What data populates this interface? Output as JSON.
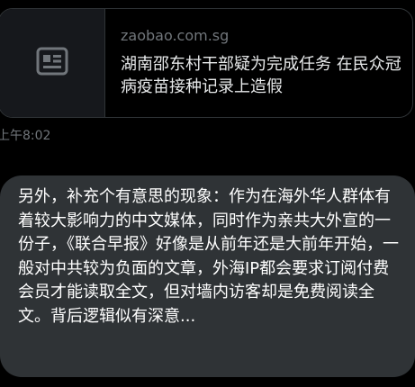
{
  "link_card": {
    "thumbnail_icon": "newspaper-icon",
    "domain": "zaobao.com.sg",
    "title": "湖南邵东村干部疑为完成任务 在民众冠病疫苗接种记录上造假"
  },
  "message": {
    "timestamp": "上午8:02",
    "text": "另外，补充个有意思的现象：作为在海外华人群体有着较大影响力的中文媒体，同时作为亲共大外宣的一份子，《联合早报》好像是从前年还是大前年开始，一般对中共较为负面的文章，外海IP都会要求订阅付费会员才能读取全文，但对墙内访客却是免费阅读全文。背后逻辑似有深意..."
  },
  "colors": {
    "background": "#000000",
    "card_border": "#2f3336",
    "thumb_background": "#16181c",
    "muted_text": "#71767b",
    "primary_text": "#e7e9ea",
    "bubble_background": "#2f3336"
  }
}
